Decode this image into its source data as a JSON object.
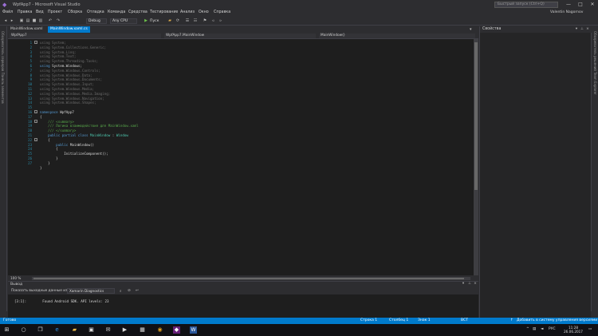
{
  "window": {
    "title": "WpfApp7 - Microsoft Visual Studio",
    "quick_launch": "Быстрый запуск (Ctrl+Q)",
    "min": "—",
    "max": "□",
    "close": "✕"
  },
  "menu": {
    "items": [
      "Файл",
      "Правка",
      "Вид",
      "Проект",
      "Сборка",
      "Отладка",
      "Команда",
      "Средства",
      "Тестирование",
      "Анализ",
      "Окно",
      "Справка"
    ],
    "user": "Valentin Nagornov"
  },
  "toolbar": {
    "config": "Debug",
    "platform": "Any CPU",
    "start": "Пуск"
  },
  "left_strip": {
    "label": "Обозреватель серверов  Панель элементов"
  },
  "right_strip": {
    "label": "Обозреватель решений  Team Explorer"
  },
  "tabs": [
    {
      "label": "MainWindow.xaml"
    },
    {
      "label": "MainWindow.xaml.cs"
    }
  ],
  "nav": {
    "project": "WpfApp7",
    "class": "WpfApp7.MainWindow",
    "member": "MainWindow()"
  },
  "code": {
    "line_numbers": [
      "1",
      "2",
      "3",
      "4",
      "5",
      "6",
      "7",
      "8",
      "9",
      "10",
      "11",
      "12",
      "13",
      "14",
      "15",
      "16",
      "17",
      "18",
      "19",
      "20",
      "21",
      "22",
      "23",
      "24",
      "25",
      "26",
      "27"
    ],
    "lines": {
      "u1_kw": "using",
      "u1_rest": " System;",
      "u2_kw": "using",
      "u2_rest": " System.Collections.Generic;",
      "u3_kw": "using",
      "u3_rest": " System.Linq;",
      "u4_kw": "using",
      "u4_rest": " System.Text;",
      "u5_kw": "using",
      "u5_rest": " System.Threading.Tasks;",
      "u6_kw": "using",
      "u6_rest": " System.Windows;",
      "u7_kw": "using",
      "u7_rest": " System.Windows.Controls;",
      "u8_kw": "using",
      "u8_rest": " System.Windows.Data;",
      "u9_kw": "using",
      "u9_rest": " System.Windows.Documents;",
      "u10_kw": "using",
      "u10_rest": " System.Windows.Input;",
      "u11_kw": "using",
      "u11_rest": " System.Windows.Media;",
      "u12_kw": "using",
      "u12_rest": " System.Windows.Media.Imaging;",
      "u13_kw": "using",
      "u13_rest": " System.Windows.Navigation;",
      "u14_kw": "using",
      "u14_rest": " System.Windows.Shapes;",
      "ns_kw": "namespace",
      "ns_rest": " WpfApp7",
      "brace_open": "{",
      "sum1": "    /// <summary>",
      "sum2": "    /// Логика взаимодействия для MainWindow.xaml",
      "sum3": "    /// </summary>",
      "cls_kw": "    public partial class",
      "cls_name": " MainWindow",
      "cls_rest": " : ",
      "cls_base": "Window",
      "cls_open": "    {",
      "ctor_kw": "        public",
      "ctor_rest": " MainWindow()",
      "ctor_open": "        {",
      "init": "            InitializeComponent();",
      "ctor_close": "        }",
      "cls_close": "    }",
      "brace_close": "}"
    }
  },
  "zoom": "100 %",
  "output": {
    "title": "Вывод",
    "show_label": "Показать выходные данные из:",
    "source": "Xamarin Diagnostics",
    "text": "[3:1]:        Found Android SDK. API levels: 23"
  },
  "properties": {
    "title": "Свойства"
  },
  "status": {
    "ready": "Готово",
    "line": "Строка 1",
    "col": "Столбец 1",
    "ch": "Знак 1",
    "ins": "ВСТ",
    "source_control": "Добавить в систему управления версиями"
  },
  "taskbar": {
    "lang": "РУС",
    "time": "11:28",
    "date": "26.06.2017"
  },
  "colors": {
    "accent": "#007acc",
    "editor_bg": "#1e1e1e",
    "keyword": "#569cd6",
    "comment": "#57a64a",
    "type": "#4ec9b0",
    "line_number": "#2b91af"
  }
}
